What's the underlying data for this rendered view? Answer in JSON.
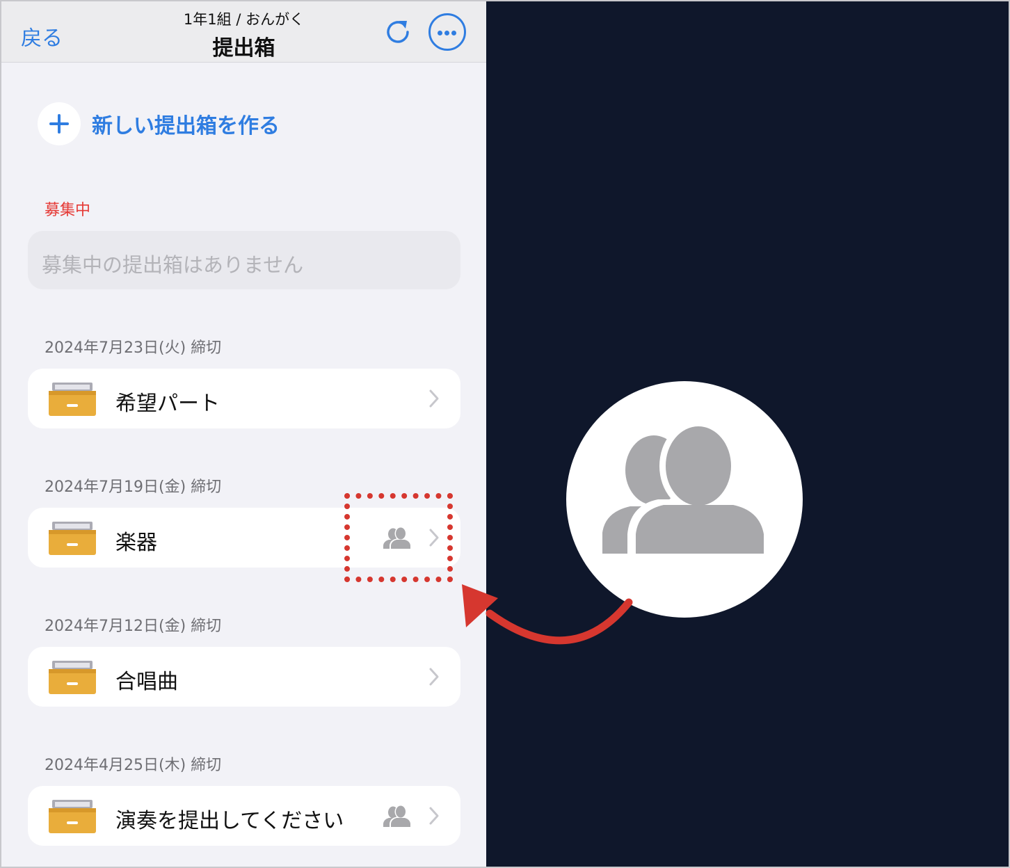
{
  "nav": {
    "back_label": "戻る",
    "subtitle": "1年1組 / おんがく",
    "title": "提出箱",
    "reload_icon": "reload-icon",
    "more_icon": "more-icon"
  },
  "new_box": {
    "label": "新しい提出箱を作る",
    "icon": "plus-icon"
  },
  "open_section": {
    "header": "募集中",
    "empty_text": "募集中の提出箱はありません"
  },
  "groups": [
    {
      "deadline": "2024年7月23日(火) 締切",
      "item": {
        "title": "希望パート",
        "has_people_icon": false
      }
    },
    {
      "deadline": "2024年7月19日(金) 締切",
      "item": {
        "title": "楽器",
        "has_people_icon": true
      }
    },
    {
      "deadline": "2024年7月12日(金) 締切",
      "item": {
        "title": "合唱曲",
        "has_people_icon": false
      }
    },
    {
      "deadline": "2024年4月25日(木) 締切",
      "item": {
        "title": "演奏を提出してください",
        "has_people_icon": true
      }
    }
  ],
  "colors": {
    "accent": "#2f7de1",
    "section_red": "#e53935",
    "annotation": "#d6372f",
    "drawer": "#e9ad3b",
    "right_bg": "#0f172b"
  }
}
